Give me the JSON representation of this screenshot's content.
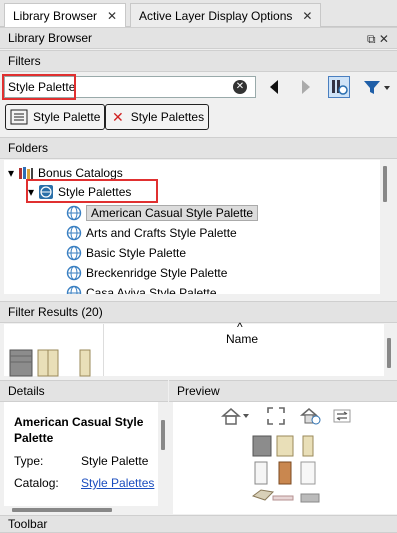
{
  "tabs": [
    {
      "label": "Library Browser",
      "active": true
    },
    {
      "label": "Active Layer Display Options",
      "active": false
    }
  ],
  "panel_title": "Library Browser",
  "panel_icons": "⧉ ✕",
  "filters": {
    "header": "Filters",
    "search_value": "Style Palette",
    "chips": [
      {
        "label": "Style Palette"
      },
      {
        "label": "Style Palettes"
      }
    ]
  },
  "folders": {
    "header": "Folders",
    "items": [
      {
        "label": "Bonus Catalogs",
        "expander": "▾",
        "level": 0
      },
      {
        "label": "Style Palettes",
        "expander": "▾",
        "level": 1
      },
      {
        "label": "American Casual Style Palette",
        "level": 2,
        "selected": true
      },
      {
        "label": "Arts and Crafts Style Palette",
        "level": 2
      },
      {
        "label": "Basic Style Palette",
        "level": 2
      },
      {
        "label": "Breckenridge Style Palette",
        "level": 2
      },
      {
        "label": "Casa Aviva Style Palette",
        "level": 2
      }
    ]
  },
  "filter_results": {
    "header": "Filter Results (20)",
    "column": "Name",
    "sort_indicator": "^"
  },
  "details": {
    "header": "Details",
    "title": "American Casual Style Palette",
    "type_label": "Type:",
    "type_value": "Style Palette",
    "catalog_label": "Catalog:",
    "catalog_value": "Style Palettes"
  },
  "preview": {
    "header": "Preview"
  },
  "toolbar": {
    "header": "Toolbar"
  },
  "colors": {
    "highlight": "#e03030",
    "link": "#1a4dbf"
  }
}
